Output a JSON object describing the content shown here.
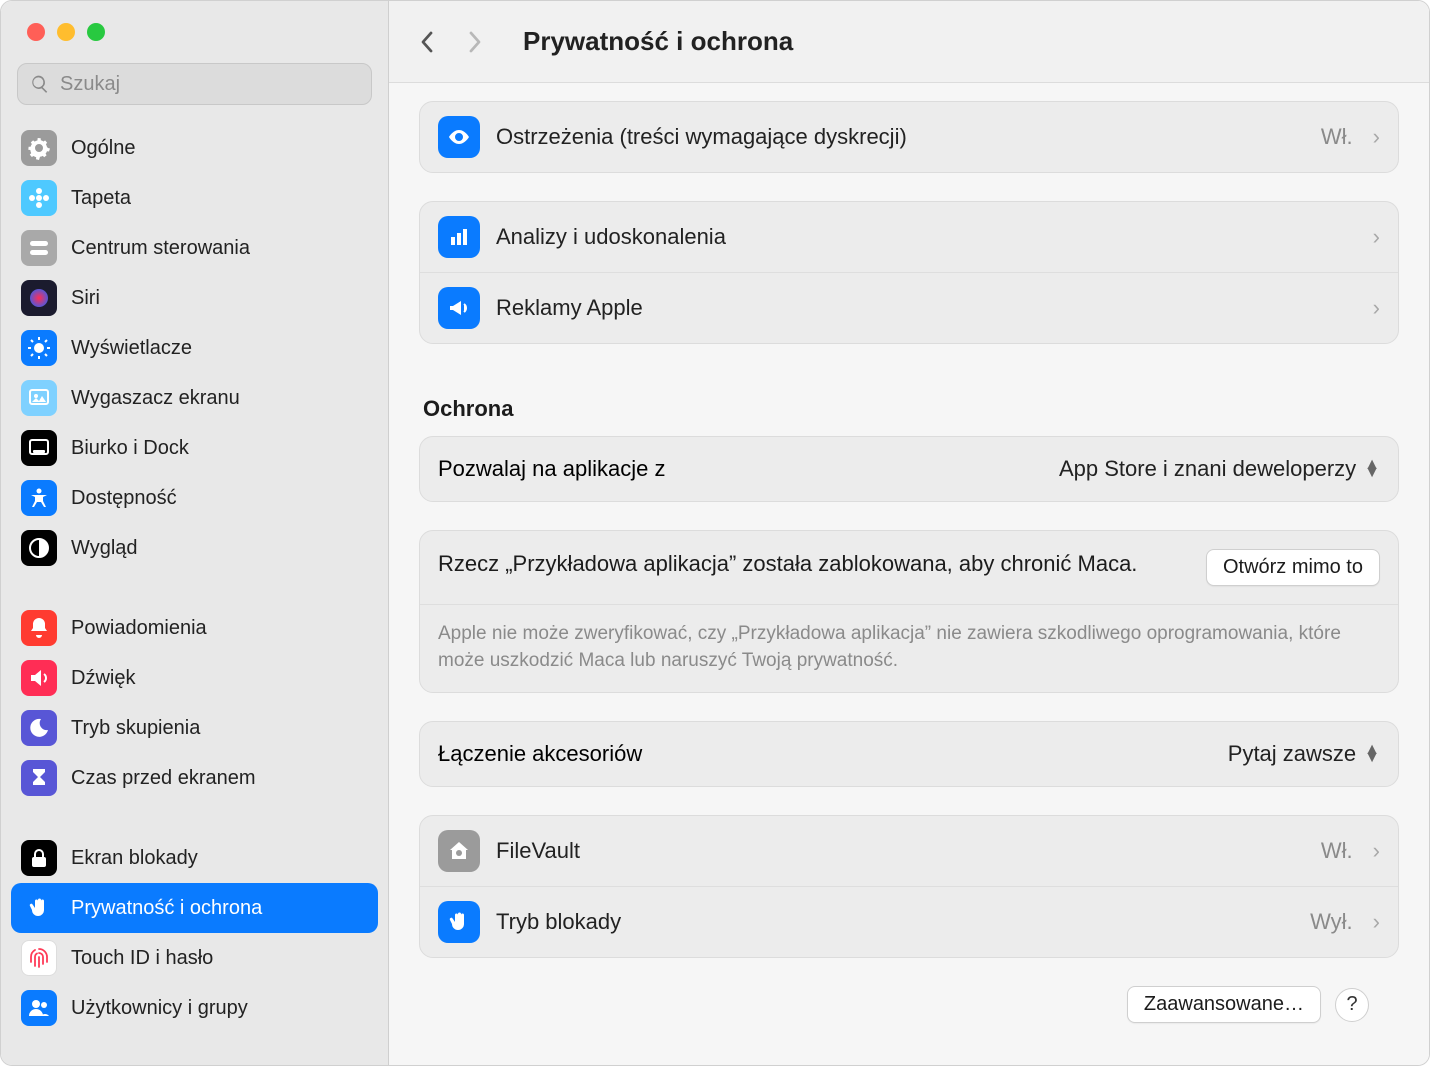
{
  "search": {
    "placeholder": "Szukaj"
  },
  "header": {
    "title": "Prywatność i ochrona"
  },
  "sidebar": [
    {
      "id": "general",
      "label": "Ogólne",
      "bg": "#9b9b9b",
      "fg": "#fff",
      "icon": "gear"
    },
    {
      "id": "wallpaper",
      "label": "Tapeta",
      "bg": "#4ec9ff",
      "fg": "#fff",
      "icon": "flower"
    },
    {
      "id": "control",
      "label": "Centrum sterowania",
      "bg": "#a9a9a9",
      "fg": "#fff",
      "icon": "switches"
    },
    {
      "id": "siri",
      "label": "Siri",
      "bg": "#1b1b2e",
      "fg": "#fff",
      "icon": "siri"
    },
    {
      "id": "display",
      "label": "Wyświetlacze",
      "bg": "#0a7bff",
      "fg": "#fff",
      "icon": "sun"
    },
    {
      "id": "screensaver",
      "label": "Wygaszacz ekranu",
      "bg": "#7fd1ff",
      "fg": "#fff",
      "icon": "ssaver"
    },
    {
      "id": "dock",
      "label": "Biurko i Dock",
      "bg": "#000",
      "fg": "#fff",
      "icon": "dock"
    },
    {
      "id": "access",
      "label": "Dostępność",
      "bg": "#0a7bff",
      "fg": "#fff",
      "icon": "access"
    },
    {
      "id": "appearance",
      "label": "Wygląd",
      "bg": "#000",
      "fg": "#fff",
      "icon": "appear"
    },
    {
      "gap": true
    },
    {
      "id": "notif",
      "label": "Powiadomienia",
      "bg": "#ff3b30",
      "fg": "#fff",
      "icon": "bell"
    },
    {
      "id": "sound",
      "label": "Dźwięk",
      "bg": "#ff2d55",
      "fg": "#fff",
      "icon": "sound"
    },
    {
      "id": "focus",
      "label": "Tryb skupienia",
      "bg": "#5856d6",
      "fg": "#fff",
      "icon": "moon"
    },
    {
      "id": "screentime",
      "label": "Czas przed ekranem",
      "bg": "#5856d6",
      "fg": "#fff",
      "icon": "hourglass"
    },
    {
      "gap": true
    },
    {
      "id": "lockscreen",
      "label": "Ekran blokady",
      "bg": "#000",
      "fg": "#fff",
      "icon": "lock"
    },
    {
      "id": "privacy",
      "label": "Prywatność i ochrona",
      "bg": "#0a7bff",
      "fg": "#fff",
      "icon": "hand",
      "selected": true
    },
    {
      "id": "touchid",
      "label": "Touch ID i hasło",
      "bg": "#fff",
      "fg": "#ff3b57",
      "icon": "finger",
      "border": true
    },
    {
      "id": "users",
      "label": "Użytkownicy i grupy",
      "bg": "#0a7bff",
      "fg": "#fff",
      "icon": "users"
    }
  ],
  "top_group": [
    {
      "id": "sensitive",
      "label": "Ostrzeżenia (treści wymagające dyskrecji)",
      "icon": "eye",
      "bg": "#0a7bff",
      "status": "Wł."
    }
  ],
  "second_group": [
    {
      "id": "analytics",
      "label": "Analizy i udoskonalenia",
      "icon": "chart",
      "bg": "#0a7bff"
    },
    {
      "id": "ads",
      "label": "Reklamy Apple",
      "icon": "megaphone",
      "bg": "#0a7bff"
    }
  ],
  "security": {
    "header": "Ochrona",
    "allow_apps": {
      "label": "Pozwalaj na aplikacje z",
      "value": "App Store i znani deweloperzy"
    },
    "blocked": {
      "text": "Rzecz „Przykładowa aplikacja” została zablokowana, aby chronić Maca.",
      "button": "Otwórz mimo to",
      "desc": "Apple nie może zweryfikować, czy „Przykładowa aplikacja” nie zawiera szkodliwego oprogramowania, które może uszkodzić Maca lub naruszyć Twoją prywatność."
    },
    "accessories": {
      "label": "Łączenie akcesoriów",
      "value": "Pytaj zawsze"
    },
    "rows": [
      {
        "id": "filevault",
        "label": "FileVault",
        "icon": "house",
        "bg": "#9b9b9b",
        "status": "Wł."
      },
      {
        "id": "lockdown",
        "label": "Tryb blokady",
        "icon": "hand",
        "bg": "#0a7bff",
        "status": "Wył."
      }
    ]
  },
  "footer": {
    "advanced": "Zaawansowane…",
    "help": "?"
  }
}
